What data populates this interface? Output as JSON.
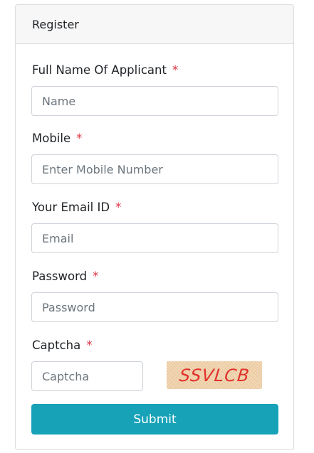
{
  "card": {
    "title": "Register"
  },
  "form": {
    "required_marker": "*",
    "full_name": {
      "label": "Full Name Of Applicant",
      "placeholder": "Name",
      "value": ""
    },
    "mobile": {
      "label": "Mobile",
      "placeholder": "Enter Mobile Number",
      "value": ""
    },
    "email": {
      "label": "Your Email ID",
      "placeholder": "Email",
      "value": ""
    },
    "password": {
      "label": "Password",
      "placeholder": "Password",
      "value": ""
    },
    "captcha": {
      "label": "Captcha",
      "placeholder": "Captcha",
      "value": "",
      "image_text": "SSVLCB"
    },
    "submit_label": "Submit"
  },
  "colors": {
    "accent": "#17a2b8",
    "required": "#dc3545",
    "captcha_text": "#e0322c"
  }
}
